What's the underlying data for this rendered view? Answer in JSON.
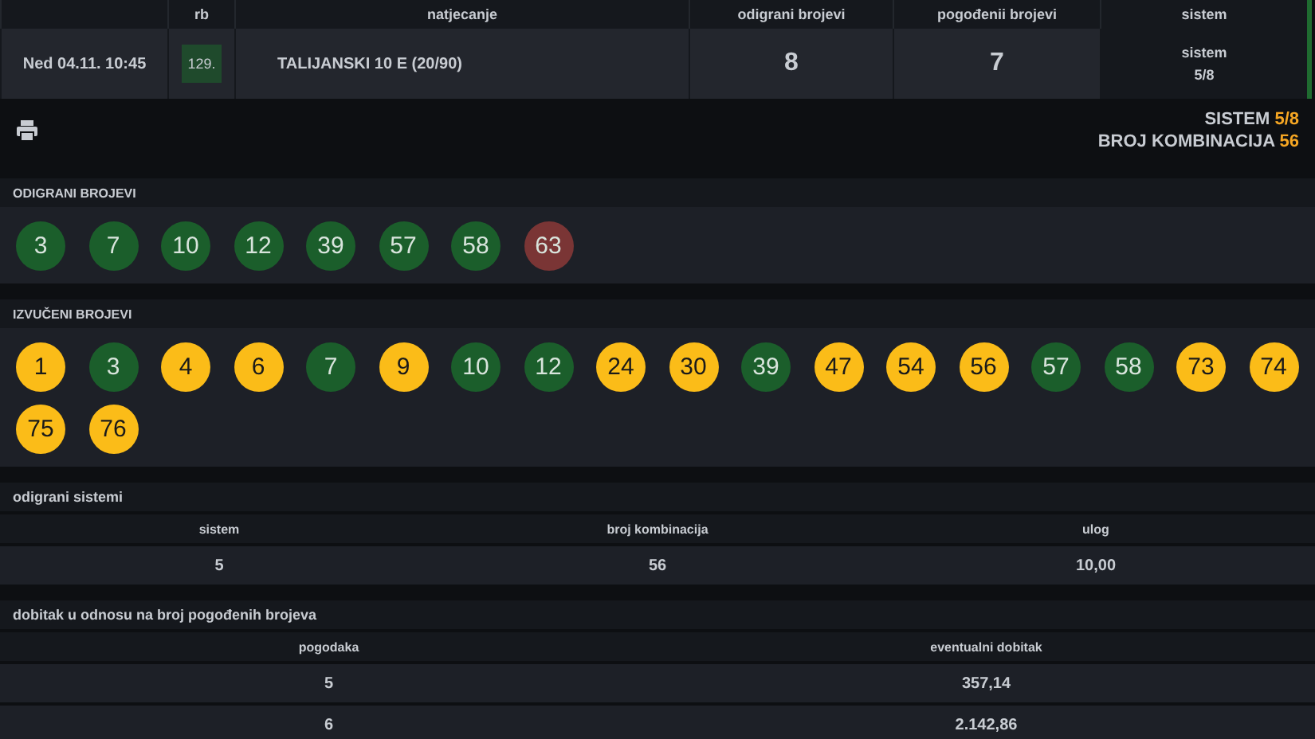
{
  "ticket": {
    "columns": [
      "",
      "rb",
      "natjecanje",
      "odigrani brojevi",
      "pogođenii brojevi",
      "sistem"
    ],
    "row": {
      "date": "Ned 04.11. 10:45",
      "rb": "129.",
      "competition": "TALIJANSKI 10 E (20/90)",
      "played": "8",
      "hit": "7",
      "system_label": "sistem",
      "system_value": "5/8"
    }
  },
  "summary": [
    {
      "label": "SISTEM",
      "value": "5/8"
    },
    {
      "label": "BROJ KOMBINACIJA",
      "value": "56"
    }
  ],
  "played_numbers": {
    "title": "ODIGRANI BROJEVI",
    "balls": [
      {
        "number": "3",
        "color": "#1b5e2b"
      },
      {
        "number": "7",
        "color": "#1b5e2b"
      },
      {
        "number": "10",
        "color": "#1b5e2b"
      },
      {
        "number": "12",
        "color": "#1b5e2b"
      },
      {
        "number": "39",
        "color": "#1b5e2b"
      },
      {
        "number": "57",
        "color": "#1b5e2b"
      },
      {
        "number": "58",
        "color": "#1b5e2b"
      },
      {
        "number": "63",
        "color": "#7a3535"
      }
    ]
  },
  "drawn_numbers": {
    "title": "IZVUČENI BROJEVI",
    "balls": [
      {
        "number": "1",
        "color": "#fbbc18"
      },
      {
        "number": "3",
        "color": "#1b5e2b"
      },
      {
        "number": "4",
        "color": "#fbbc18"
      },
      {
        "number": "6",
        "color": "#fbbc18"
      },
      {
        "number": "7",
        "color": "#1b5e2b"
      },
      {
        "number": "9",
        "color": "#fbbc18"
      },
      {
        "number": "10",
        "color": "#1b5e2b"
      },
      {
        "number": "12",
        "color": "#1b5e2b"
      },
      {
        "number": "24",
        "color": "#fbbc18"
      },
      {
        "number": "30",
        "color": "#fbbc18"
      },
      {
        "number": "39",
        "color": "#1b5e2b"
      },
      {
        "number": "47",
        "color": "#fbbc18"
      },
      {
        "number": "54",
        "color": "#fbbc18"
      },
      {
        "number": "56",
        "color": "#fbbc18"
      },
      {
        "number": "57",
        "color": "#1b5e2b"
      },
      {
        "number": "58",
        "color": "#1b5e2b"
      },
      {
        "number": "73",
        "color": "#fbbc18"
      },
      {
        "number": "74",
        "color": "#fbbc18"
      },
      {
        "number": "75",
        "color": "#fbbc18"
      },
      {
        "number": "76",
        "color": "#fbbc18"
      }
    ]
  },
  "systems": {
    "title": "odigrani sistemi",
    "columns": [
      "sistem",
      "broj kombinacija",
      "ulog"
    ],
    "rows": [
      [
        "5",
        "56",
        "10,00"
      ]
    ]
  },
  "winnings": {
    "title": "dobitak u odnosu na broj pogođenih brojeva",
    "columns": [
      "pogodaka",
      "eventualni dobitak"
    ],
    "rows": [
      [
        "5",
        "357,14"
      ],
      [
        "6",
        "2.142,86"
      ]
    ]
  }
}
